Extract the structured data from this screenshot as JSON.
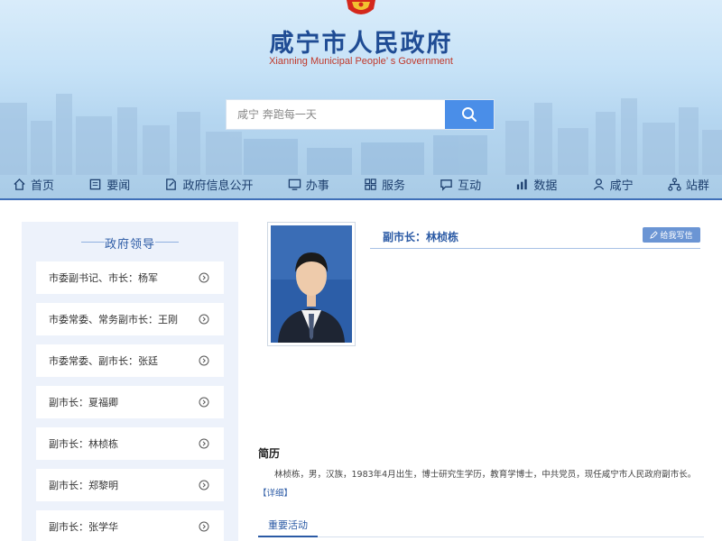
{
  "header": {
    "site_title": "咸宁市人民政府",
    "site_subtitle": "Xianning Municipal People’ s Government"
  },
  "search": {
    "placeholder": "咸宁 奔跑每一天"
  },
  "nav": {
    "items": [
      {
        "label": "首页",
        "icon": "home-icon"
      },
      {
        "label": "要闻",
        "icon": "news-icon"
      },
      {
        "label": "政府信息公开",
        "icon": "document-icon"
      },
      {
        "label": "办事",
        "icon": "monitor-icon"
      },
      {
        "label": "服务",
        "icon": "grid-icon"
      },
      {
        "label": "互动",
        "icon": "chat-icon"
      },
      {
        "label": "数据",
        "icon": "bar-chart-icon"
      },
      {
        "label": "咸宁",
        "icon": "person-icon"
      },
      {
        "label": "站群",
        "icon": "sitemap-icon"
      }
    ]
  },
  "sidebar": {
    "title": "政府领导",
    "items": [
      {
        "label": "市委副书记、市长：杨军"
      },
      {
        "label": "市委常委、常务副市长：王刚"
      },
      {
        "label": "市委常委、副市长：张廷"
      },
      {
        "label": "副市长：夏福卿"
      },
      {
        "label": "副市长：林桢栋"
      },
      {
        "label": "副市长：郑黎明"
      },
      {
        "label": "副市长：张学华"
      }
    ]
  },
  "profile": {
    "title": "副市长：林桢栋",
    "correction_label": "给我写信",
    "resume_heading": "简历",
    "resume_text": "林桢栋，男，汉族，1983年4月出生，博士研究生学历，教育学博士，中共党员，现任咸宁市人民政府副市长。",
    "detail_link": "【详细】",
    "activities_tab": "重要活动"
  },
  "colors": {
    "brand_blue": "#2b5aa5",
    "title_blue": "#1f4c94",
    "subtitle_red": "#c0392b",
    "search_button": "#4a8ee8",
    "sidebar_bg": "#edf2fb"
  }
}
